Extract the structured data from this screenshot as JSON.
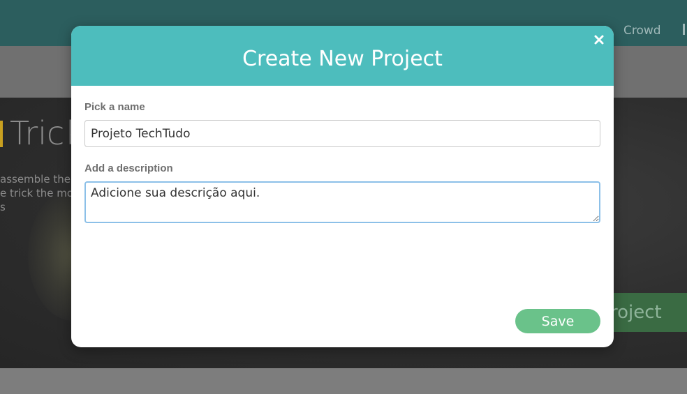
{
  "background": {
    "nav": {
      "crowd_label": "Crowd"
    },
    "hero": {
      "title_fragment": "Trick",
      "description_fragment": "assemble the\ne trick the mo\ns",
      "cta_fragment": "roject"
    }
  },
  "modal": {
    "title": "Create New Project",
    "close_icon": "close-icon",
    "name_label": "Pick a name",
    "name_value": "Projeto TechTudo",
    "description_label": "Add a description",
    "description_value": "Adicione sua descrição aqui.",
    "save_label": "Save"
  },
  "colors": {
    "header": "#4dbdbd",
    "save_button": "#6ac28a",
    "topbar": "#2c5e5e"
  }
}
